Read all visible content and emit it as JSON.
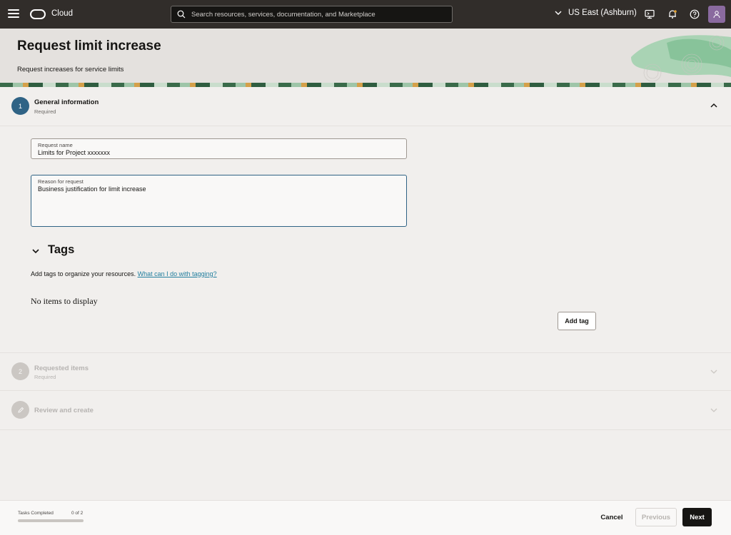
{
  "topbar": {
    "brand": "Cloud",
    "search_placeholder": "Search resources, services, documentation, and Marketplace",
    "region": "US East (Ashburn)"
  },
  "header": {
    "title": "Request limit increase",
    "subtitle": "Request increases for service limits"
  },
  "steps": [
    {
      "number": "1",
      "title": "General information",
      "status": "Required",
      "state": "active"
    },
    {
      "number": "2",
      "title": "Requested items",
      "status": "Required",
      "state": "disabled"
    },
    {
      "number": "",
      "title": "Review and create",
      "status": "",
      "state": "disabled"
    }
  ],
  "form": {
    "request_name": {
      "label": "Request name",
      "value": "Limits for Project xxxxxxx"
    },
    "reason": {
      "label": "Reason for request",
      "value": "Business justification for limit increase"
    }
  },
  "tags": {
    "title": "Tags",
    "description": "Add tags to organize your resources.",
    "link": "What can I do with tagging?",
    "empty": "No items to display",
    "add_button": "Add tag"
  },
  "footer": {
    "tasks_label": "Tasks Completed",
    "tasks_count": "0 of 2",
    "progress": 0,
    "cancel": "Cancel",
    "previous": "Previous",
    "next": "Next"
  },
  "colors": {
    "topbar": "#312d2a",
    "accent": "#2f6385",
    "link": "#227e9e",
    "avatar": "#8a6a9f"
  }
}
